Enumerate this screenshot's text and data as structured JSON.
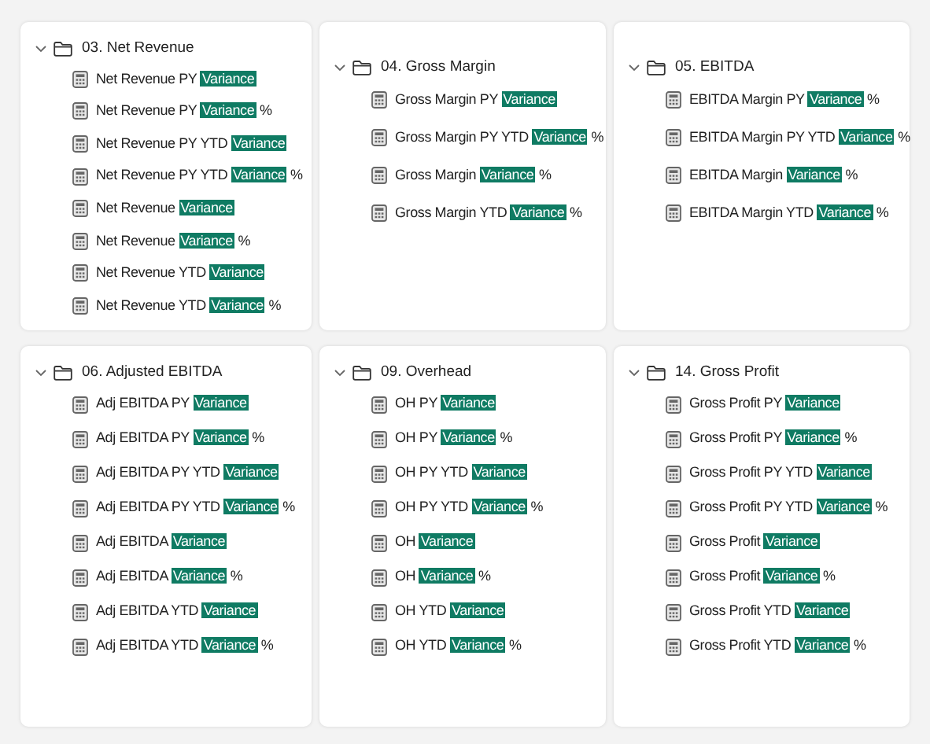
{
  "panels": [
    {
      "title": "03. Net Revenue",
      "expanded": true,
      "items": [
        {
          "text": "Net Revenue PY",
          "match": "Variance"
        },
        {
          "text": "Net Revenue PY",
          "match": "Variance",
          "suffix": "%"
        },
        {
          "text": "Net Revenue PY YTD",
          "match": "Variance"
        },
        {
          "text": "Net Revenue PY YTD",
          "match": "Variance",
          "suffix": "%"
        },
        {
          "text": "Net Revenue",
          "match": "Variance"
        },
        {
          "text": "Net Revenue",
          "match": "Variance",
          "suffix": "%"
        },
        {
          "text": "Net Revenue YTD",
          "match": "Variance"
        },
        {
          "text": "Net Revenue YTD",
          "match": "Variance",
          "suffix": "%"
        }
      ]
    },
    {
      "title": "04. Gross Margin",
      "expanded": true,
      "items": [
        {
          "text": "Gross Margin PY",
          "match": "Variance"
        },
        {
          "text": "Gross Margin PY YTD",
          "match": "Variance",
          "suffix": "%"
        },
        {
          "text": "Gross Margin",
          "match": "Variance",
          "suffix": "%"
        },
        {
          "text": "Gross Margin YTD",
          "match": "Variance",
          "suffix": "%"
        }
      ]
    },
    {
      "title": "05. EBITDA",
      "expanded": true,
      "items": [
        {
          "text": "EBITDA Margin PY",
          "match": "Variance",
          "suffix": "%"
        },
        {
          "text": "EBITDA Margin PY YTD",
          "match": "Variance",
          "suffix": "%"
        },
        {
          "text": "EBITDA Margin",
          "match": "Variance",
          "suffix": "%"
        },
        {
          "text": "EBITDA Margin YTD",
          "match": "Variance",
          "suffix": "%"
        }
      ]
    },
    {
      "title": "06. Adjusted EBITDA",
      "expanded": true,
      "items": [
        {
          "text": "Adj EBITDA PY",
          "match": "Variance"
        },
        {
          "text": "Adj EBITDA PY",
          "match": "Variance",
          "suffix": "%"
        },
        {
          "text": "Adj EBITDA PY YTD",
          "match": "Variance"
        },
        {
          "text": "Adj EBITDA PY YTD",
          "match": "Variance",
          "suffix": "%"
        },
        {
          "text": "Adj EBITDA",
          "match": "Variance"
        },
        {
          "text": "Adj EBITDA",
          "match": "Variance",
          "suffix": "%"
        },
        {
          "text": "Adj EBITDA YTD",
          "match": "Variance"
        },
        {
          "text": "Adj EBITDA YTD",
          "match": "Variance",
          "suffix": "%"
        }
      ]
    },
    {
      "title": "09. Overhead",
      "expanded": true,
      "items": [
        {
          "text": "OH PY",
          "match": "Variance"
        },
        {
          "text": "OH PY",
          "match": "Variance",
          "suffix": "%"
        },
        {
          "text": "OH PY YTD",
          "match": "Variance"
        },
        {
          "text": "OH PY YTD",
          "match": "Variance",
          "suffix": "%"
        },
        {
          "text": "OH",
          "match": "Variance"
        },
        {
          "text": "OH",
          "match": "Variance",
          "suffix": "%"
        },
        {
          "text": "OH YTD",
          "match": "Variance"
        },
        {
          "text": "OH YTD",
          "match": "Variance",
          "suffix": "%"
        }
      ]
    },
    {
      "title": "14. Gross Profit",
      "expanded": true,
      "items": [
        {
          "text": "Gross Profit PY",
          "match": "Variance"
        },
        {
          "text": "Gross Profit PY",
          "match": "Variance",
          "suffix": "%"
        },
        {
          "text": "Gross Profit PY YTD",
          "match": "Variance"
        },
        {
          "text": "Gross Profit PY YTD",
          "match": "Variance",
          "suffix": "%"
        },
        {
          "text": "Gross Profit",
          "match": "Variance"
        },
        {
          "text": "Gross Profit",
          "match": "Variance",
          "suffix": "%"
        },
        {
          "text": "Gross Profit YTD",
          "match": "Variance"
        },
        {
          "text": "Gross Profit YTD",
          "match": "Variance",
          "suffix": "%"
        }
      ]
    }
  ]
}
